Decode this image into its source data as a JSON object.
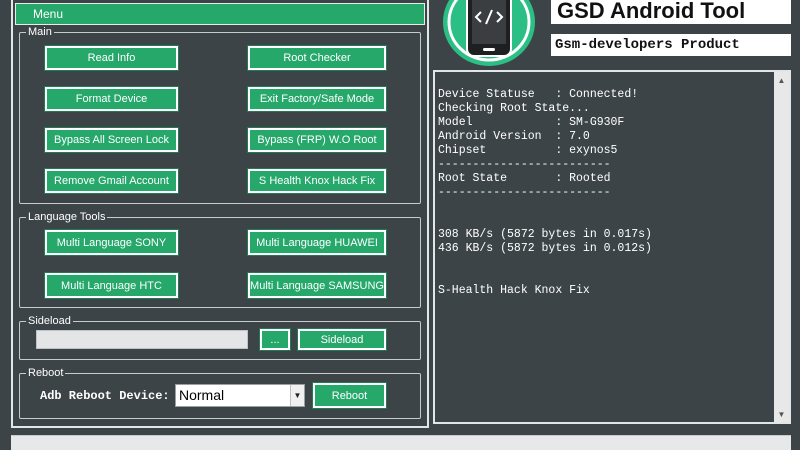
{
  "menu": {
    "label": "Menu"
  },
  "groups": {
    "main": {
      "label": "Main",
      "buttons": [
        "Read Info",
        "Root Checker",
        "Format Device",
        "Exit Factory/Safe Mode",
        "Bypass All Screen  Lock",
        "Bypass (FRP) W.O Root",
        "Remove Gmail Account",
        "S Health Knox Hack Fix"
      ]
    },
    "language": {
      "label": "Language Tools",
      "buttons": [
        "Multi Language SONY",
        "Multi Language HUAWEI",
        "Multi Language HTC",
        "Multi Language SAMSUNG"
      ]
    },
    "sideload": {
      "label": "Sideload",
      "browse_label": "...",
      "button_label": "Sideload",
      "input_value": ""
    },
    "reboot": {
      "label": "Reboot",
      "adb_label": "Adb Reboot Device:",
      "selected_mode": "Normal",
      "button_label": "Reboot"
    }
  },
  "header": {
    "title": "GSD Android Tool",
    "subtitle": "Gsm-developers Product"
  },
  "log": {
    "lines": [
      "Device Statuse   : Connected!",
      "Checking Root State...",
      "Model            : SM-G930F",
      "Android Version  : 7.0",
      "Chipset          : exynos5",
      "-------------------------",
      "Root State       : Rooted",
      "-------------------------",
      "",
      "",
      "308 KB/s (5872 bytes in 0.017s)",
      "436 KB/s (5872 bytes in 0.012s)",
      "",
      "",
      "S-Health Hack Knox Fix"
    ]
  },
  "colors": {
    "accent": "#26a86b",
    "background": "#3d4448",
    "logo_circle": "#2bbf86"
  },
  "icons": {
    "logo": "phone-code-icon",
    "dropdown": "chevron-down-icon"
  }
}
